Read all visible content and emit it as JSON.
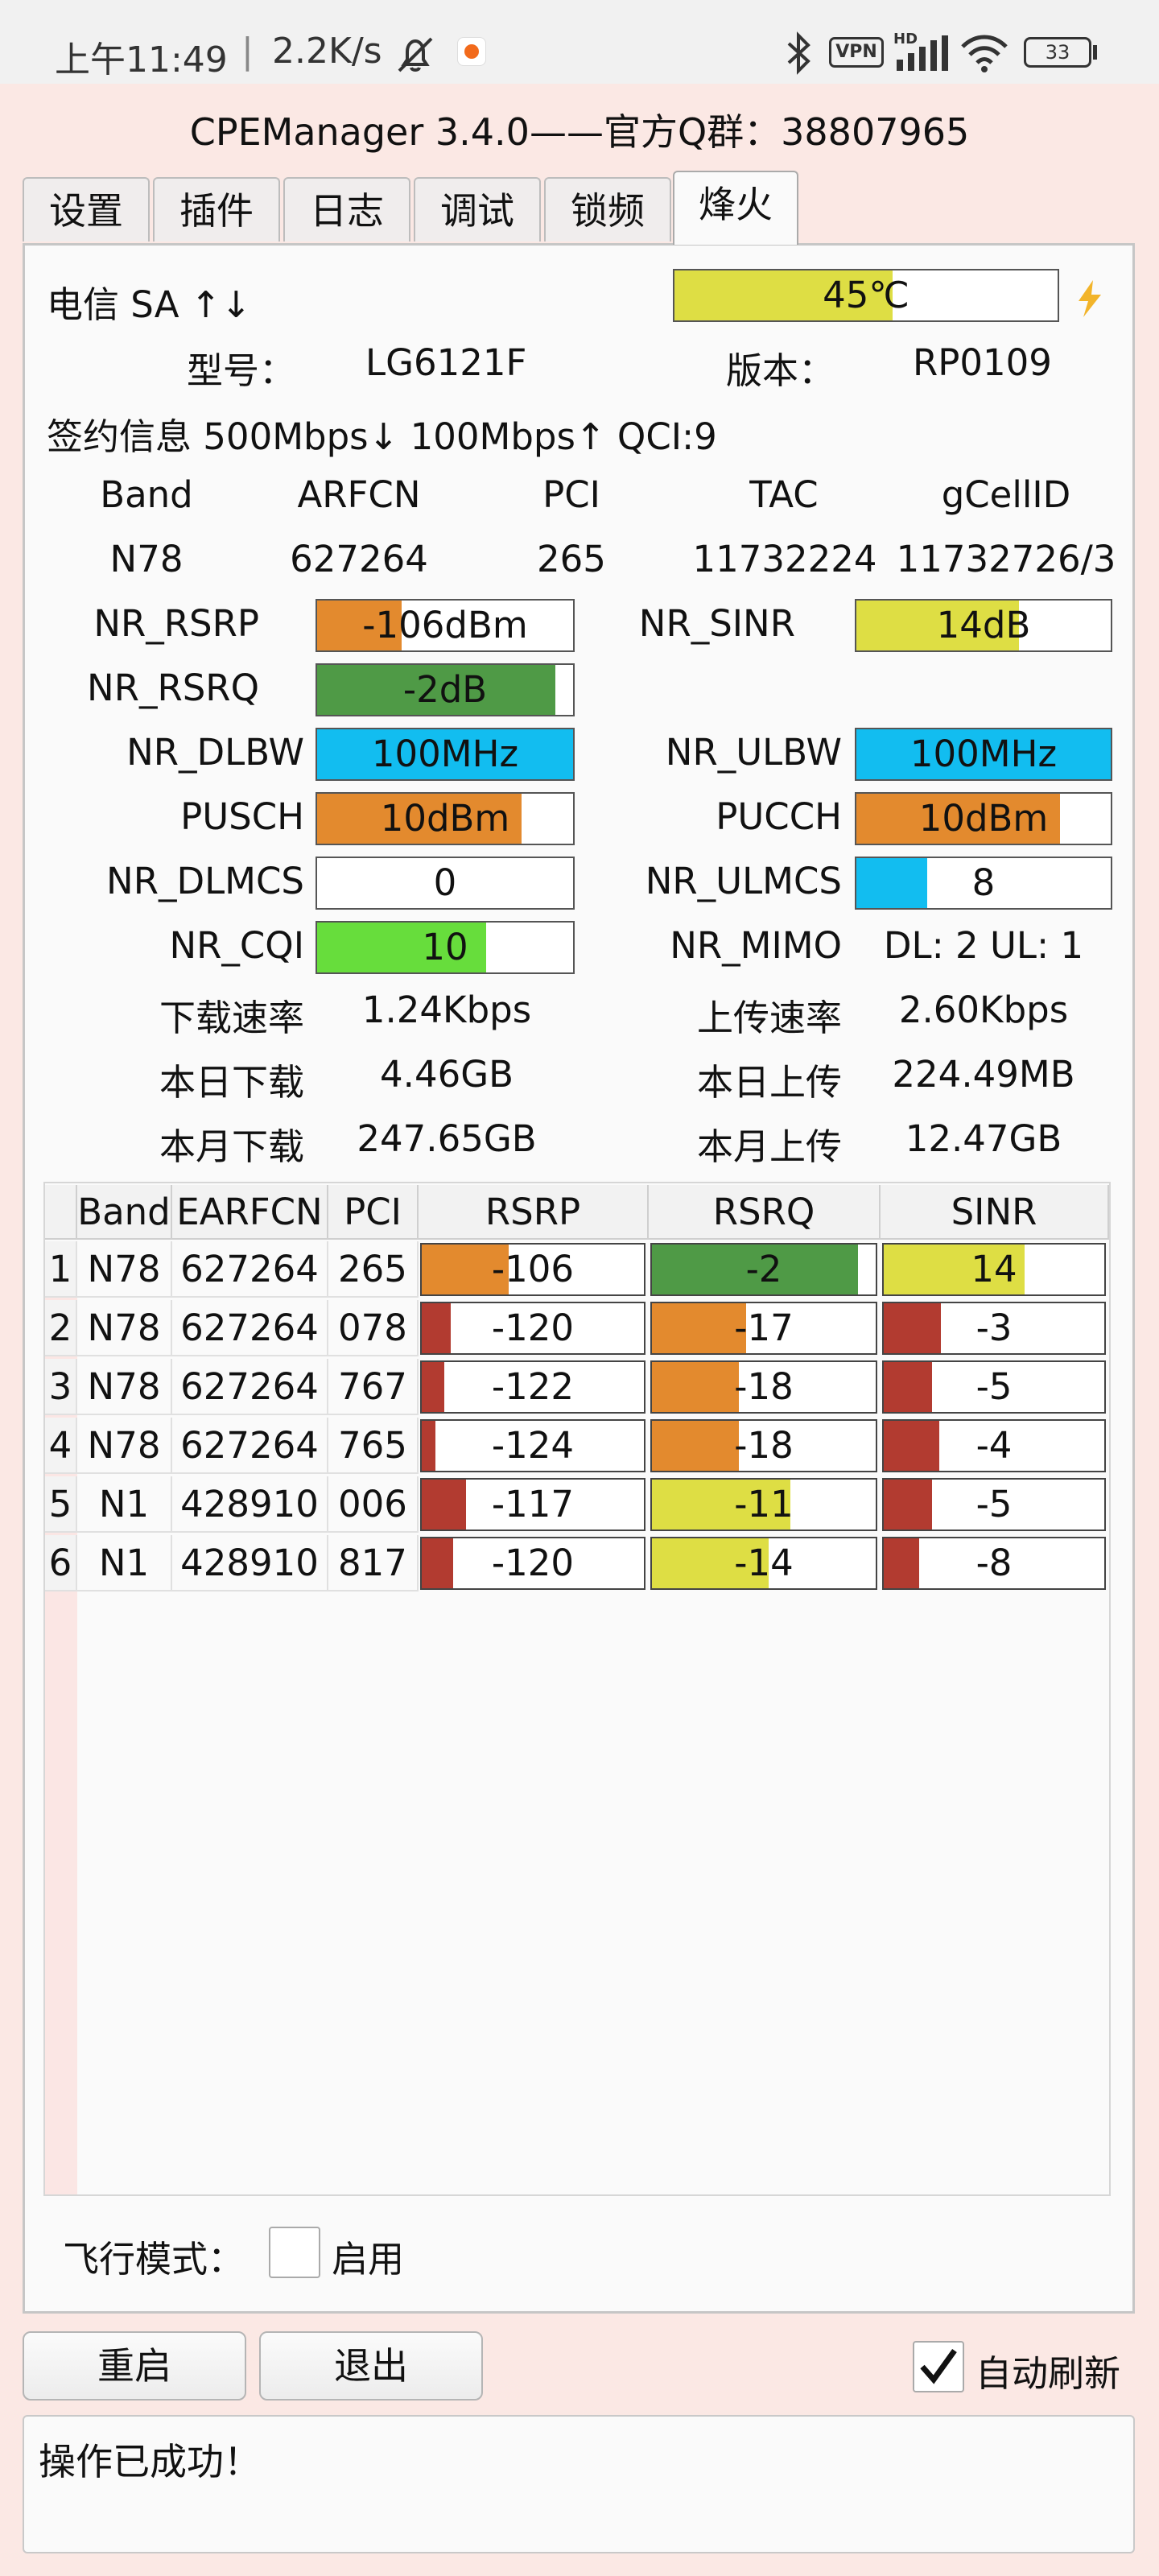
{
  "statusbar": {
    "time": "上午11:49",
    "speed": "2.2K/s",
    "vpn": "VPN",
    "hd": "HD",
    "battery": "33"
  },
  "app": {
    "title": "CPEManager 3.4.0——官方Q群：38807965"
  },
  "tabs": [
    "设置",
    "插件",
    "日志",
    "调试",
    "锁频",
    "烽火"
  ],
  "active_tab": "烽火",
  "info": {
    "carrier": "电信 SA ↑↓",
    "temperature": {
      "label": "45℃",
      "value": 45,
      "fraction": 0.57,
      "color": "#dede44"
    },
    "model_label": "型号：",
    "model": "LG6121F",
    "version_label": "版本：",
    "version": "RP0109",
    "subscription": "签约信息 500Mbps↓ 100Mbps↑ QCI:9"
  },
  "cell_header": [
    "Band",
    "ARFCN",
    "PCI",
    "TAC",
    "gCellID"
  ],
  "cell_values": [
    "N78",
    "627264",
    "265",
    "11732224",
    "11732726/3"
  ],
  "metrics": {
    "nr_rsrp": {
      "label": "NR_RSRP",
      "value": "-106dBm",
      "fraction": 0.33,
      "color": "#e38a2e"
    },
    "nr_sinr": {
      "label": "NR_SINR",
      "value": "14dB",
      "fraction": 0.64,
      "color": "#dede44"
    },
    "nr_rsrq": {
      "label": "NR_RSRQ",
      "value": "-2dB",
      "fraction": 0.93,
      "color": "#4f9a46"
    },
    "nr_dlbw": {
      "label": "NR_DLBW",
      "value": "100MHz",
      "fraction": 1.0,
      "color": "#12bdf0"
    },
    "nr_ulbw": {
      "label": "NR_ULBW",
      "value": "100MHz",
      "fraction": 1.0,
      "color": "#12bdf0"
    },
    "pusch": {
      "label": "PUSCH",
      "value": "10dBm",
      "fraction": 0.8,
      "color": "#e38a2e"
    },
    "pucch": {
      "label": "PUCCH",
      "value": "10dBm",
      "fraction": 0.8,
      "color": "#e38a2e"
    },
    "nr_dlmcs": {
      "label": "NR_DLMCS",
      "value": "0",
      "fraction": 0.0,
      "color": "#12bdf0"
    },
    "nr_ulmcs": {
      "label": "NR_ULMCS",
      "value": "8",
      "fraction": 0.28,
      "color": "#12bdf0"
    },
    "nr_cqi": {
      "label": "NR_CQI",
      "value": "10",
      "fraction": 0.66,
      "color": "#67dd3c"
    },
    "nr_mimo": {
      "label": "NR_MIMO",
      "value": "DL: 2 UL: 1"
    }
  },
  "traffic": {
    "dl_rate_label": "下载速率",
    "dl_rate": "1.24Kbps",
    "ul_rate_label": "上传速率",
    "ul_rate": "2.60Kbps",
    "day_dl_label": "本日下载",
    "day_dl": "4.46GB",
    "day_ul_label": "本日上传",
    "day_ul": "224.49MB",
    "month_dl_label": "本月下载",
    "month_dl": "247.65GB",
    "month_ul_label": "本月上传",
    "month_ul": "12.47GB"
  },
  "neighbor_table": {
    "headers": [
      "Band",
      "EARFCN",
      "PCI",
      "RSRP",
      "RSRQ",
      "SINR"
    ],
    "rows": [
      {
        "idx": "1",
        "band": "N78",
        "earfcn": "627264",
        "pci": "265",
        "rsrp": {
          "value": "-106",
          "fraction": 0.39,
          "color": "#e38a2e"
        },
        "rsrq": {
          "value": "-2",
          "fraction": 0.92,
          "color": "#4f9a46"
        },
        "sinr": {
          "value": "14",
          "fraction": 0.64,
          "color": "#dede44"
        }
      },
      {
        "idx": "2",
        "band": "N78",
        "earfcn": "627264",
        "pci": "078",
        "rsrp": {
          "value": "-120",
          "fraction": 0.13,
          "color": "#b23b30"
        },
        "rsrq": {
          "value": "-17",
          "fraction": 0.42,
          "color": "#e38a2e"
        },
        "sinr": {
          "value": "-3",
          "fraction": 0.26,
          "color": "#b23b30"
        }
      },
      {
        "idx": "3",
        "band": "N78",
        "earfcn": "627264",
        "pci": "767",
        "rsrp": {
          "value": "-122",
          "fraction": 0.1,
          "color": "#b23b30"
        },
        "rsrq": {
          "value": "-18",
          "fraction": 0.39,
          "color": "#e38a2e"
        },
        "sinr": {
          "value": "-5",
          "fraction": 0.22,
          "color": "#b23b30"
        }
      },
      {
        "idx": "4",
        "band": "N78",
        "earfcn": "627264",
        "pci": "765",
        "rsrp": {
          "value": "-124",
          "fraction": 0.06,
          "color": "#b23b30"
        },
        "rsrq": {
          "value": "-18",
          "fraction": 0.39,
          "color": "#e38a2e"
        },
        "sinr": {
          "value": "-4",
          "fraction": 0.25,
          "color": "#b23b30"
        }
      },
      {
        "idx": "5",
        "band": "N1",
        "earfcn": "428910",
        "pci": "006",
        "rsrp": {
          "value": "-117",
          "fraction": 0.2,
          "color": "#b23b30"
        },
        "rsrq": {
          "value": "-11",
          "fraction": 0.62,
          "color": "#dede44"
        },
        "sinr": {
          "value": "-5",
          "fraction": 0.22,
          "color": "#b23b30"
        }
      },
      {
        "idx": "6",
        "band": "N1",
        "earfcn": "428910",
        "pci": "817",
        "rsrp": {
          "value": "-120",
          "fraction": 0.14,
          "color": "#b23b30"
        },
        "rsrq": {
          "value": "-14",
          "fraction": 0.52,
          "color": "#dede44"
        },
        "sinr": {
          "value": "-8",
          "fraction": 0.16,
          "color": "#b23b30"
        }
      }
    ]
  },
  "airplane": {
    "label": "飞行模式：",
    "option": "启用",
    "checked": false
  },
  "buttons": {
    "reboot": "重启",
    "exit": "退出"
  },
  "auto_refresh": {
    "label": "自动刷新",
    "checked": true
  },
  "message": "操作已成功！"
}
